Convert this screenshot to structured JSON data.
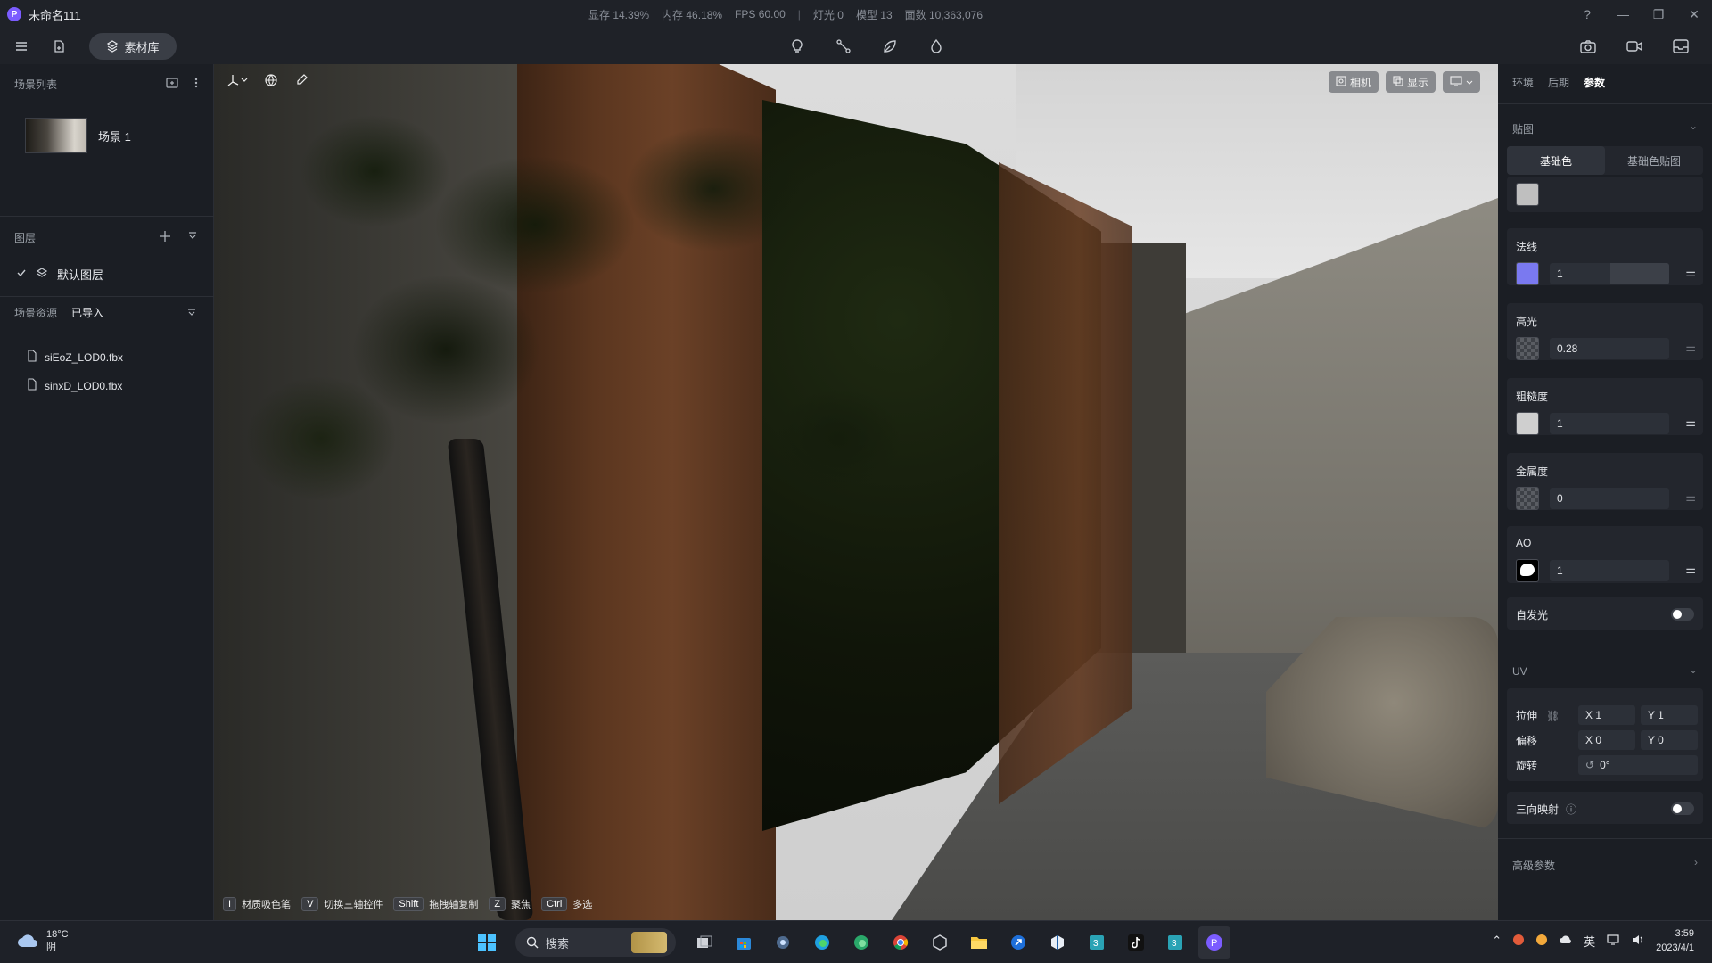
{
  "app": {
    "title": "未命名111",
    "window_controls": [
      "?",
      "—",
      "❐",
      "✕"
    ]
  },
  "stats": [
    {
      "label": "显存 14.39%"
    },
    {
      "label": "内存 46.18%"
    },
    {
      "label": "FPS 60.00"
    },
    {
      "label": "|"
    },
    {
      "label": "灯光 0"
    },
    {
      "label": "模型 13"
    },
    {
      "label": "面数 10,363,076"
    }
  ],
  "toolbar": {
    "library_label": "素材库"
  },
  "left_panel": {
    "scene_list_title": "场景列表",
    "scenes": [
      {
        "name": "场景 1"
      }
    ],
    "layers_title": "图层",
    "layers": [
      {
        "name": "默认图层",
        "checked": true
      }
    ],
    "resources_tab_1": "场景资源",
    "resources_tab_2": "已导入",
    "files": [
      {
        "name": "siEoZ_LOD0.fbx"
      },
      {
        "name": "sinxD_LOD0.fbx"
      }
    ]
  },
  "viewport": {
    "camera_label": "相机",
    "display_label": "显示",
    "hints": [
      {
        "key": "I",
        "text": "材质吸色笔"
      },
      {
        "key": "V",
        "text": "切换三轴控件"
      },
      {
        "key": "Shift",
        "text": "拖拽轴复制"
      },
      {
        "key": "Z",
        "text": "聚焦"
      },
      {
        "key": "Ctrl",
        "text": "多选"
      }
    ]
  },
  "right_panel": {
    "tabs": [
      "环境",
      "后期",
      "参数"
    ],
    "active_tab": "参数",
    "texture_section": "贴图",
    "subtab_base_color": "基础色",
    "subtab_base_color_map": "基础色贴图",
    "normal": {
      "label": "法线",
      "value": "1"
    },
    "specular": {
      "label": "高光",
      "value": "0.28"
    },
    "roughness": {
      "label": "粗糙度",
      "value": "1"
    },
    "metalness": {
      "label": "金属度",
      "value": "0"
    },
    "ao": {
      "label": "AO",
      "value": "1"
    },
    "emissive_label": "自发光",
    "uv_section": "UV",
    "stretch": {
      "label": "拉伸",
      "x": "X 1",
      "y": "Y 1"
    },
    "offset": {
      "label": "偏移",
      "x": "X 0",
      "y": "Y 0"
    },
    "rotation": {
      "label": "旋转",
      "value": "0°"
    },
    "triplanar_label": "三向映射",
    "advanced_label": "高级参数"
  },
  "taskbar": {
    "temperature": "18°C",
    "condition": "阴",
    "search_placeholder": "搜索",
    "ime": "英",
    "time": "3:59",
    "date": "2023/4/1"
  },
  "colors": {
    "accent": "#7b5cff",
    "normal_swatch": "#7a79f0"
  }
}
